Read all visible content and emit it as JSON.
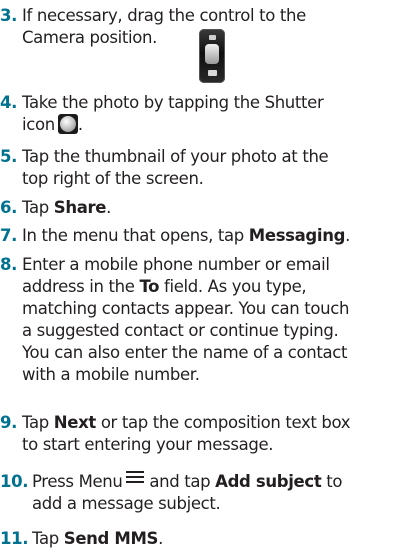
{
  "steps": [
    {
      "num": "3.",
      "parts": [
        "If necessary, drag the control to the",
        "Camera position."
      ]
    },
    {
      "num": "4.",
      "pre": "Take the photo by tapping the Shutter",
      "post": "icon",
      "end": "."
    },
    {
      "num": "5.",
      "parts": [
        "Tap the thumbnail of your photo at the",
        "top right of the screen."
      ]
    },
    {
      "num": "6.",
      "pre": "Tap ",
      "bold": "Share",
      "post": "."
    },
    {
      "num": "7.",
      "pre": "In the menu that opens, tap ",
      "bold": "Messaging",
      "post": "."
    },
    {
      "num": "8.",
      "l1": "Enter a mobile phone number or email",
      "l2_pre": "address in the ",
      "l2_bold": "To",
      "l2_post": " field. As you type,",
      "l3": "matching contacts appear. You can touch",
      "l4": "a suggested contact or continue typing.",
      "l5": "You can also enter the name of a contact",
      "l6": "with a mobile number."
    },
    {
      "num": "9.",
      "l1_pre": "Tap ",
      "l1_bold": "Next",
      "l1_post": " or tap the composition text box",
      "l2": "to start entering your message."
    },
    {
      "num": "10.",
      "l1_pre": "Press Menu",
      "l1_mid": " and tap ",
      "l1_bold": "Add subject",
      "l1_post": " to",
      "l2": "add a message subject."
    },
    {
      "num": "11.",
      "pre": "Tap ",
      "bold": "Send MMS",
      "post": "."
    }
  ],
  "icons": {
    "camera_switch": "camera-video-switch-icon",
    "shutter": "shutter-icon",
    "menu": "menu-icon"
  }
}
